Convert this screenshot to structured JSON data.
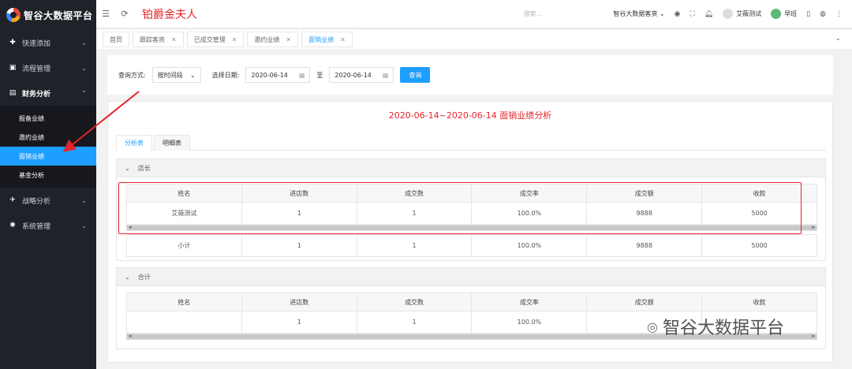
{
  "app": {
    "title": "智谷大数据平台"
  },
  "sidebar": {
    "items": [
      {
        "label": "快速添加",
        "icon": "plus-circle-icon",
        "glyph": "✚"
      },
      {
        "label": "流程管理",
        "icon": "briefcase-icon",
        "glyph": "▣"
      },
      {
        "label": "财务分析",
        "icon": "chart-icon",
        "glyph": "▤"
      },
      {
        "label": "战略分析",
        "icon": "plane-icon",
        "glyph": "✈"
      },
      {
        "label": "系统管理",
        "icon": "gear-icon",
        "glyph": "✺"
      }
    ],
    "submenu": [
      {
        "label": "报备业绩"
      },
      {
        "label": "邀约业绩"
      },
      {
        "label": "面销业绩"
      },
      {
        "label": "基金分析"
      }
    ]
  },
  "header": {
    "page_title": "铂爵金夫人",
    "search_placeholder": "搜索...",
    "org_select": "智谷大数据客资",
    "user_name": "艾薇测试",
    "status": "早班"
  },
  "tabs": [
    {
      "label": "首页"
    },
    {
      "label": "跟踪客资"
    },
    {
      "label": "已成交管理"
    },
    {
      "label": "邀约业绩"
    },
    {
      "label": "面销业绩"
    }
  ],
  "query": {
    "mode_label": "查询方式:",
    "mode_value": "按时间段",
    "date_label": "选择日期:",
    "start_date": "2020-06-14",
    "to_label": "至",
    "end_date": "2020-06-14",
    "search_button": "查询"
  },
  "report": {
    "title": "2020-06-14~2020-06-14 面销业绩分析",
    "tabs": [
      {
        "label": "分析表"
      },
      {
        "label": "明细表"
      }
    ],
    "columns": [
      "姓名",
      "进店数",
      "成交数",
      "成交率",
      "成交额",
      "收款"
    ],
    "group1": {
      "name": "店长",
      "rows": [
        [
          "艾薇测试",
          "1",
          "1",
          "100.0%",
          "9888",
          "5000"
        ]
      ],
      "subtotal": [
        "小计",
        "1",
        "1",
        "100.0%",
        "9888",
        "5000"
      ]
    },
    "group2": {
      "name": "合计",
      "rows": [
        [
          "",
          "1",
          "1",
          "100.0%",
          "",
          ""
        ]
      ]
    }
  },
  "watermark": {
    "text": "智谷大数据平台"
  },
  "colors": {
    "accent": "#1e9fff",
    "brand_red": "#e3252b",
    "sidebar_bg": "#20222a"
  }
}
